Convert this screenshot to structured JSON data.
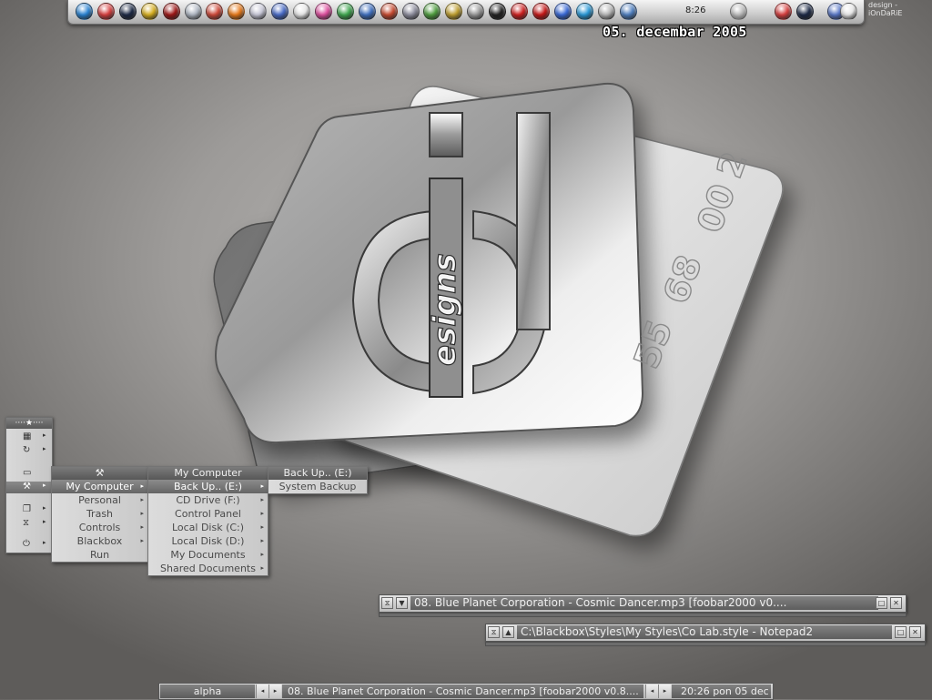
{
  "dock": {
    "clock": "8:26",
    "items": [
      {
        "icon": "ie-icon",
        "color": "#2a84d4"
      },
      {
        "icon": "calendar-icon",
        "color": "#d84040"
      },
      {
        "icon": "blackbox-icon",
        "color": "#1d2a46"
      },
      {
        "icon": "crosshair-icon",
        "color": "#d8b020"
      },
      {
        "icon": "media-red-icon",
        "color": "#a01818"
      },
      {
        "icon": "globe-icon",
        "color": "#b0b8c4"
      },
      {
        "icon": "diamond-icon",
        "color": "#d04a3a"
      },
      {
        "icon": "firefox-icon",
        "color": "#e87a1a"
      },
      {
        "icon": "disc-icon",
        "color": "#c8c8d8"
      },
      {
        "icon": "window-icon",
        "color": "#4a6cc8"
      },
      {
        "icon": "flower-icon",
        "color": "#e8e8e8"
      },
      {
        "icon": "palette-icon",
        "color": "#e050a0"
      },
      {
        "icon": "play-icon",
        "color": "#40a850"
      },
      {
        "icon": "monitor-icon",
        "color": "#4070c0"
      },
      {
        "icon": "paint-icon",
        "color": "#c84a30"
      },
      {
        "icon": "tools-icon",
        "color": "#9090a0"
      },
      {
        "icon": "gear-green-icon",
        "color": "#50a040"
      },
      {
        "icon": "gear-yellow-icon",
        "color": "#c0a030"
      },
      {
        "icon": "gear-grey-icon",
        "color": "#9a9a9a"
      },
      {
        "icon": "target-icon",
        "color": "#222222"
      },
      {
        "icon": "shield-red-icon",
        "color": "#d02020"
      },
      {
        "icon": "k-icon",
        "color": "#c81818"
      },
      {
        "icon": "globe-blue-icon",
        "color": "#3a6ad8"
      },
      {
        "icon": "network-icon",
        "color": "#2a9ad8"
      },
      {
        "icon": "wrench-icon",
        "color": "#b8b8b8"
      },
      {
        "icon": "pen-icon",
        "color": "#5080c0"
      }
    ],
    "right_items": [
      {
        "icon": "calendar-icon",
        "color": "#d84040"
      },
      {
        "icon": "blackbox-icon",
        "color": "#1d2a46"
      },
      {
        "icon": "wand-icon",
        "color": "#5a78c8"
      },
      {
        "icon": "flower-icon",
        "color": "#e8e8e8"
      }
    ]
  },
  "credit": "design - iOnDaRiE",
  "date": "05. decembar 2005",
  "logo": {
    "letter": "d",
    "word": "esigns",
    "stamp_lines": [
      "2",
      "00",
      "68",
      "55"
    ]
  },
  "left_panel": {
    "items": [
      {
        "icon": "grid-icon",
        "glyph": "▦"
      },
      {
        "icon": "refresh-icon",
        "glyph": "↻"
      },
      {
        "icon": "folder-icon",
        "glyph": "▭"
      },
      {
        "icon": "tools-icon",
        "glyph": "⚒"
      },
      {
        "icon": "window-icon",
        "glyph": "❐"
      },
      {
        "icon": "hourglass-icon",
        "glyph": "⧖"
      },
      {
        "icon": "power-icon",
        "glyph": "⏻"
      }
    ]
  },
  "menus": {
    "main": {
      "title_glyph": "⚒",
      "items": [
        {
          "label": "My Computer",
          "sub": true,
          "selected": true
        },
        {
          "label": "Personal",
          "sub": true
        },
        {
          "label": "Trash",
          "sub": true
        },
        {
          "label": "Controls",
          "sub": true
        },
        {
          "label": "Blackbox",
          "sub": true
        },
        {
          "label": "Run",
          "sub": false
        }
      ]
    },
    "computer": {
      "title": "My Computer",
      "items": [
        {
          "label": "Back Up.. (E:)",
          "sub": true,
          "selected": true
        },
        {
          "label": "CD Drive (F:)",
          "sub": true
        },
        {
          "label": "Control Panel",
          "sub": true
        },
        {
          "label": "Local Disk (C:)",
          "sub": true
        },
        {
          "label": "Local Disk (D:)",
          "sub": true
        },
        {
          "label": "My Documents",
          "sub": true
        },
        {
          "label": "Shared Documents",
          "sub": true
        }
      ]
    },
    "backup": {
      "title": "Back Up.. (E:)",
      "items": [
        {
          "label": "System Backup",
          "sub": false
        }
      ]
    }
  },
  "windows": {
    "foobar": {
      "title": "08. Blue Planet Corporation - Cosmic Dancer.mp3     [foobar2000 v0...."
    },
    "notepad": {
      "title": "C:\\Blackbox\\Styles\\My Styles\\Co Lab.style - Notepad2"
    }
  },
  "taskbar": {
    "workspace": "alpha",
    "task": "08. Blue Planet Corporation - Cosmic Dancer.mp3     [foobar2000 v0.8....",
    "clock": "20:26 pon 05 dec"
  }
}
